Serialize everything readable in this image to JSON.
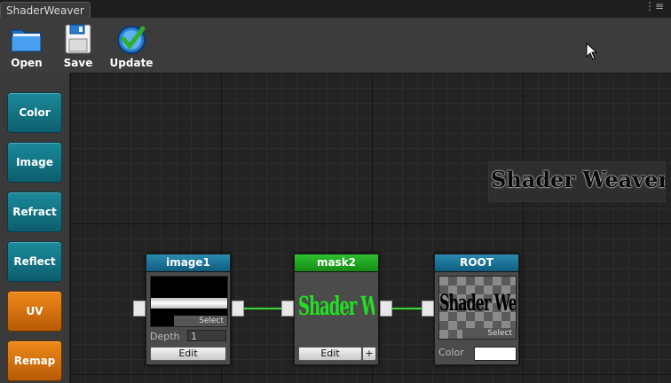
{
  "window": {
    "tab_title": "ShaderWeaver"
  },
  "toolbar": {
    "open_label": "Open",
    "save_label": "Save",
    "update_label": "Update"
  },
  "sidebar": {
    "items": [
      "Color",
      "Image",
      "Refract",
      "Reflect",
      "UV",
      "Remap"
    ]
  },
  "canvas": {
    "watermark": "Shader Weaver"
  },
  "nodes": {
    "image1": {
      "title": "image1",
      "select_label": "Select",
      "depth_label": "Depth",
      "depth_value": "1",
      "edit_label": "Edit"
    },
    "mask2": {
      "title": "mask2",
      "preview_text": "Shader Weaver",
      "edit_label": "Edit",
      "add_label": "+"
    },
    "root": {
      "title": "ROOT",
      "preview_text": "Shader Weaver",
      "select_label": "Select",
      "color_label": "Color"
    }
  },
  "colors": {
    "accent_teal": "#0d5d6e",
    "accent_orange": "#b85a05",
    "wire_green": "#3fd23f",
    "node_header_green": "#158a15",
    "node_header_blue": "#0f5d7f"
  }
}
